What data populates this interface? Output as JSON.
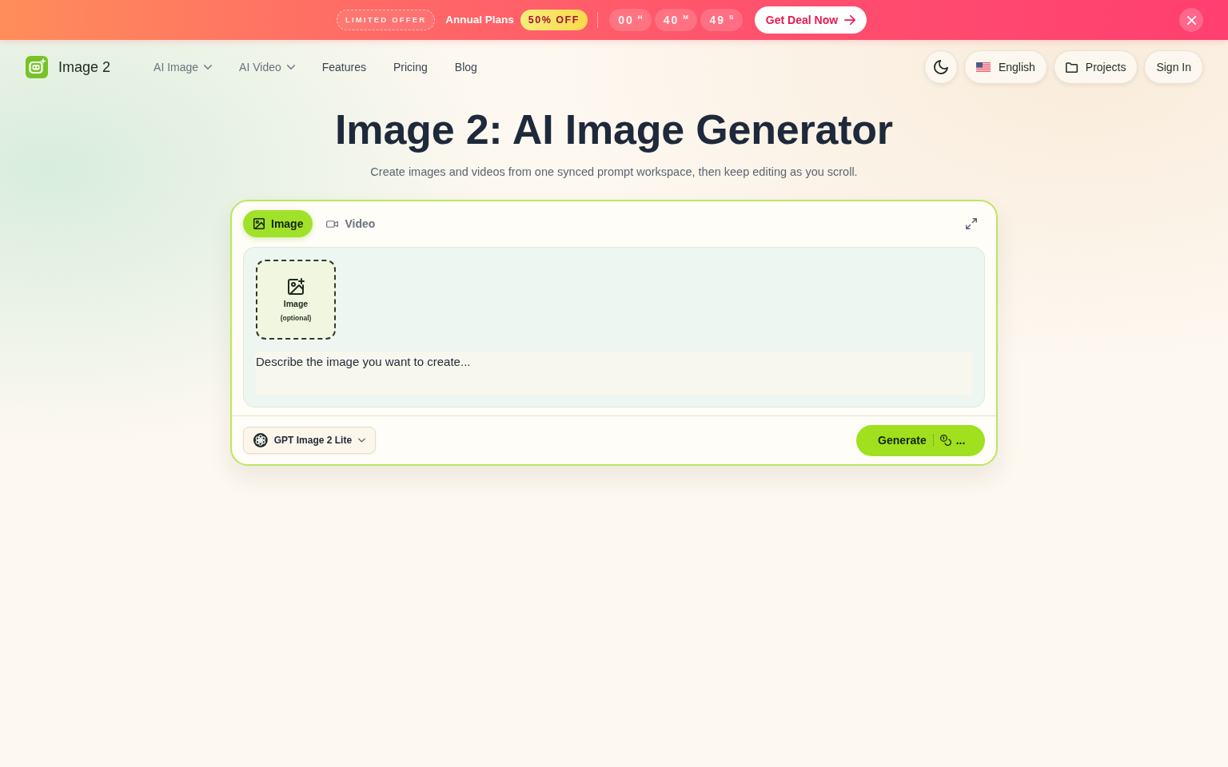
{
  "promo_banner": {
    "badge": "LIMITED OFFER",
    "plan": "Annual Plans",
    "discount": "50% OFF",
    "countdown": [
      {
        "value": "00",
        "unit": "H"
      },
      {
        "value": "40",
        "unit": "M"
      },
      {
        "value": "49",
        "unit": "S"
      }
    ],
    "cta": "Get Deal Now"
  },
  "navbar": {
    "brand": "Image 2",
    "links": [
      {
        "label": "AI Image",
        "dropdown": true
      },
      {
        "label": "AI Video",
        "dropdown": true
      },
      {
        "label": "Features",
        "dropdown": false
      },
      {
        "label": "Pricing",
        "dropdown": false
      },
      {
        "label": "Blog",
        "dropdown": false
      }
    ],
    "language": "English",
    "projects": "Projects",
    "sign_in": "Sign In"
  },
  "hero": {
    "title": "Image 2: AI Image Generator",
    "subtitle": "Create images and videos from one synced prompt workspace, then keep editing as you scroll."
  },
  "generator": {
    "tabs": [
      {
        "label": "Image",
        "kind": "image",
        "selected": true
      },
      {
        "label": "Video",
        "kind": "video",
        "selected": false
      }
    ],
    "upload": {
      "label": "Image",
      "hint": "(optional)"
    },
    "prompt": {
      "placeholder": "Describe the image you want to create..."
    },
    "model": "GPT Image 2 Lite",
    "generate": {
      "label": "Generate",
      "cost": "..."
    }
  }
}
